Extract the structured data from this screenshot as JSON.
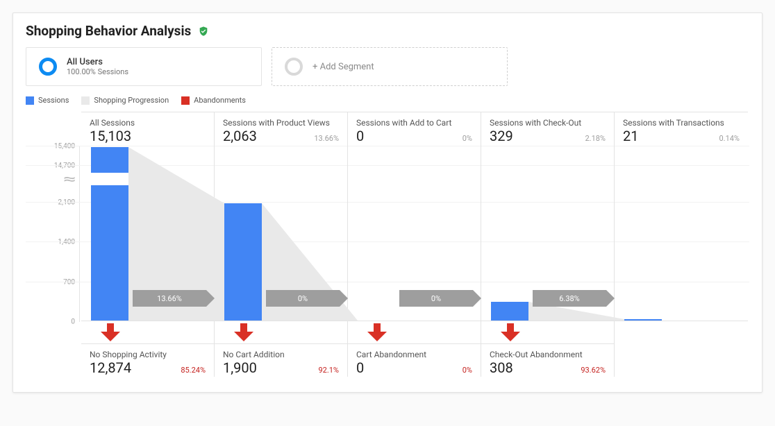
{
  "header": {
    "title": "Shopping Behavior Analysis"
  },
  "segments": {
    "all_users": {
      "label": "All Users",
      "sub": "100.00% Sessions"
    },
    "add": {
      "label": "+ Add Segment"
    }
  },
  "legend": {
    "sessions": "Sessions",
    "progression": "Shopping Progression",
    "abandonments": "Abandonments"
  },
  "chart_data": {
    "type": "bar",
    "title": "Shopping Behavior Analysis",
    "xlabel": "",
    "ylabel": "",
    "yticks_upper": [
      14700,
      15400
    ],
    "yticks_lower": [
      0,
      700,
      1400,
      2100
    ],
    "axis_break_between": [
      2100,
      14700
    ],
    "columns": [
      {
        "label": "All Sessions",
        "value": 15103,
        "pct": null,
        "progression_pct": "13.66%",
        "abandon": {
          "label": "No Shopping Activity",
          "value": 12874,
          "pct": "85.24%"
        }
      },
      {
        "label": "Sessions with Product Views",
        "value": 2063,
        "pct": "13.66%",
        "progression_pct": "0%",
        "abandon": {
          "label": "No Cart Addition",
          "value": 1900,
          "pct": "92.1%"
        }
      },
      {
        "label": "Sessions with Add to Cart",
        "value": 0,
        "pct": "0%",
        "progression_pct": "0%",
        "abandon": {
          "label": "Cart Abandonment",
          "value": 0,
          "pct": "0%"
        }
      },
      {
        "label": "Sessions with Check-Out",
        "value": 329,
        "pct": "2.18%",
        "progression_pct": "6.38%",
        "abandon": {
          "label": "Check-Out Abandonment",
          "value": 308,
          "pct": "93.62%"
        }
      },
      {
        "label": "Sessions with Transactions",
        "value": 21,
        "pct": "0.14%",
        "progression_pct": null,
        "abandon": null
      }
    ]
  },
  "colors": {
    "blue": "#4285f4",
    "grey": "#e9e9e9",
    "red": "#d93025"
  },
  "display": {
    "col0": {
      "label": "All Sessions",
      "value": "15,103"
    },
    "col1": {
      "label": "Sessions with Product Views",
      "value": "2,063",
      "pct": "13.66%"
    },
    "col2": {
      "label": "Sessions with Add to Cart",
      "value": "0",
      "pct": "0%"
    },
    "col3": {
      "label": "Sessions with Check-Out",
      "value": "329",
      "pct": "2.18%"
    },
    "col4": {
      "label": "Sessions with Transactions",
      "value": "21",
      "pct": "0.14%"
    },
    "ab0": {
      "label": "No Shopping Activity",
      "value": "12,874",
      "pct": "85.24%"
    },
    "ab1": {
      "label": "No Cart Addition",
      "value": "1,900",
      "pct": "92.1%"
    },
    "ab2": {
      "label": "Cart Abandonment",
      "value": "0",
      "pct": "0%"
    },
    "ab3": {
      "label": "Check-Out Abandonment",
      "value": "308",
      "pct": "93.62%"
    },
    "prog0": "13.66%",
    "prog1": "0%",
    "prog2": "0%",
    "prog3": "6.38%",
    "ytick": {
      "t15400": "15,400",
      "t14700": "14,700",
      "t2100": "2,100",
      "t1400": "1,400",
      "t700": "700",
      "t0": "0"
    }
  }
}
